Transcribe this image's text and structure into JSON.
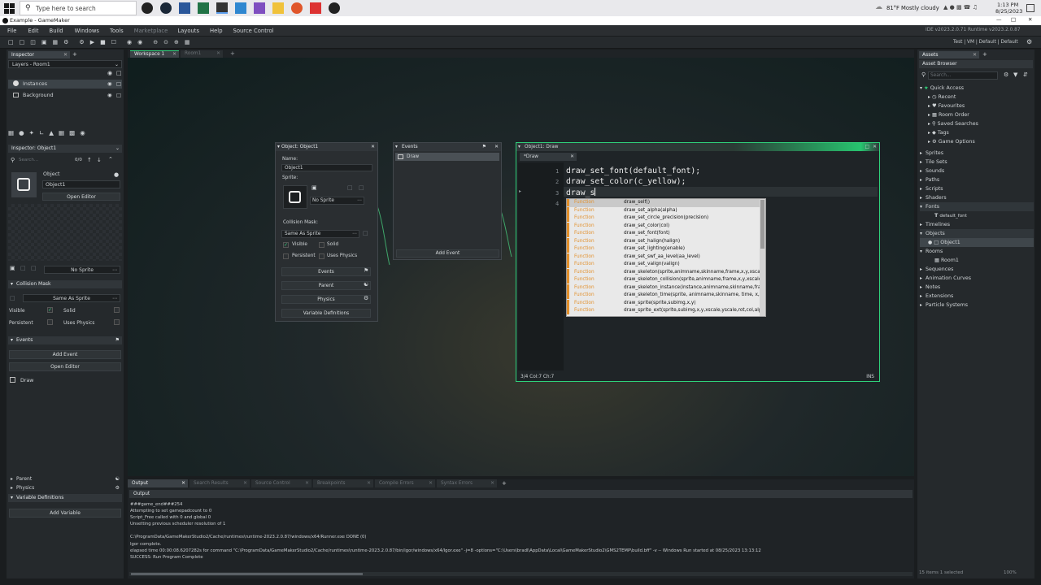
{
  "taskbar": {
    "search_placeholder": "Type here to search",
    "weather_temp": "81°F",
    "weather_desc": "Mostly cloudy",
    "time": "1:13 PM",
    "date": "8/25/2023"
  },
  "window": {
    "title": "Example - GameMaker"
  },
  "menu": [
    "File",
    "Edit",
    "Build",
    "Windows",
    "Tools",
    "Marketplace",
    "Layouts",
    "Help",
    "Source Control"
  ],
  "ide_version": "IDE v2023.2.0.71  Runtime v2023.2.0.87",
  "targets": "Test | VM | Default | Default",
  "left": {
    "inspector_tab": "Inspector",
    "layers_title": "Layers - Room1",
    "layers": [
      "Instances",
      "Background"
    ],
    "inspector_obj_tab": "Inspector: Object1",
    "search_placeholder": "Search...",
    "count": "0/0",
    "object_label": "Object",
    "object_name": "Object1",
    "open_editor": "Open Editor",
    "no_sprite": "No Sprite",
    "collision_mask": "Collision Mask",
    "same_as_sprite": "Same As Sprite",
    "visible": "Visible",
    "solid": "Solid",
    "persistent": "Persistent",
    "uses_physics": "Uses Physics",
    "events": "Events",
    "add_event": "Add Event",
    "open_editor2": "Open Editor",
    "event_item": "Draw",
    "parent": "Parent",
    "physics": "Physics",
    "variable_definitions": "Variable Definitions",
    "add_variable": "Add Variable"
  },
  "workspace": {
    "tabs": [
      "Workspace 1",
      "Room1"
    ]
  },
  "object_window": {
    "title": "Object: Object1",
    "name_label": "Name:",
    "name_value": "Object1",
    "sprite_label": "Sprite:",
    "no_sprite": "No Sprite",
    "collision_mask": "Collision Mask:",
    "mask_value": "Same As Sprite",
    "visible": "Visible",
    "solid": "Solid",
    "persistent": "Persistent",
    "uses_physics": "Uses Physics",
    "events": "Events",
    "parent": "Parent",
    "physics": "Physics",
    "variable_definitions": "Variable Definitions"
  },
  "events_window": {
    "title": "Events",
    "event": "Draw",
    "add_event": "Add Event"
  },
  "code_window": {
    "title": "Object1: Draw",
    "tab": "*Draw",
    "lines": [
      "draw_set_font(default_font);",
      "draw_set_color(c_yellow);",
      "draw_s",
      ""
    ],
    "line_numbers": [
      "1",
      "2",
      "3",
      "4"
    ],
    "status_left": "3/4 Col:7 Ch:7",
    "status_right": "INS"
  },
  "autocomplete": [
    {
      "kind": "Function",
      "text": "draw_self()"
    },
    {
      "kind": "Function",
      "text": "draw_set_alpha(alpha)"
    },
    {
      "kind": "Function",
      "text": "draw_set_circle_precision(precision)"
    },
    {
      "kind": "Function",
      "text": "draw_set_color(col)"
    },
    {
      "kind": "Function",
      "text": "draw_set_font(font)"
    },
    {
      "kind": "Function",
      "text": "draw_set_halign(halign)"
    },
    {
      "kind": "Function",
      "text": "draw_set_lighting(enable)"
    },
    {
      "kind": "Function",
      "text": "draw_set_swf_aa_level(aa_level)"
    },
    {
      "kind": "Function",
      "text": "draw_set_valign(valign)"
    },
    {
      "kind": "Function",
      "text": "draw_skeleton(sprite,animname,skinname,frame,x,y,xscale,y"
    },
    {
      "kind": "Function",
      "text": "draw_skeleton_collision(sprite,animname,frame,x,y,xscale,ys"
    },
    {
      "kind": "Function",
      "text": "draw_skeleton_instance(instance,animname,skinname,fram"
    },
    {
      "kind": "Function",
      "text": "draw_skeleton_time(sprite, animname,skinname, time, x,y, x"
    },
    {
      "kind": "Function",
      "text": "draw_sprite(sprite,subimg,x,y)"
    },
    {
      "kind": "Function",
      "text": "draw_sprite_ext(sprite,subimg,x,y,xscale,yscale,rot,col,alpha)"
    }
  ],
  "assets": {
    "tab": "Assets",
    "title": "Asset Browser",
    "search_placeholder": "Search...",
    "quick_access": "Quick Access",
    "quick": [
      "Recent",
      "Favourites",
      "Room Order",
      "Saved Searches",
      "Tags",
      "Game Options"
    ],
    "groups": [
      "Sprites",
      "Tile Sets",
      "Sounds",
      "Paths",
      "Scripts",
      "Shaders",
      "Fonts",
      "Timelines",
      "Objects",
      "Rooms",
      "Sequences",
      "Animation Curves",
      "Notes",
      "Extensions",
      "Particle Systems"
    ],
    "font_item": "default_font",
    "object_item": "Object1",
    "room_item": "Room1",
    "footer": "15 items   1 selected",
    "zoom": "100%"
  },
  "output": {
    "tabs": [
      "Output",
      "Search Results",
      "Source Control",
      "Breakpoints",
      "Compile Errors",
      "Syntax Errors"
    ],
    "header": "Output",
    "lines": [
      "###game_end###254",
      "Attempting to set gamepadcount to 0",
      "Script_Free called with 0 and global 0",
      "Unsetting previous scheduler resolution of 1",
      "",
      "C:\\ProgramData/GameMakerStudio2/Cache/runtimes\\runtime-2023.2.0.87/windows/x64/Runner.exe DONE (0)",
      "Igor complete.",
      "elapsed time 00:00:08.6207282s for command \"C:\\ProgramData/GameMakerStudio2/Cache/runtimes\\runtime-2023.2.0.87/bin/igor/windows/x64/Igor.exe\" -j=8  -options=\"C:\\Users\\bradl\\AppData\\Local\\GameMakerStudio2\\GMS2TEMP\\build.bff\" -v -- Windows Run started at 08/25/2023 13:13:12",
      "SUCCESS: Run Program Complete"
    ]
  },
  "colors": {
    "accent_green": "#2fd17a",
    "function_orange": "#e2902c",
    "code_text": "#e8e8e8"
  }
}
